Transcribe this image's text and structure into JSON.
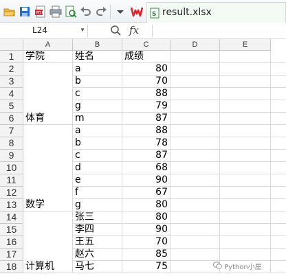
{
  "window": {
    "tab_title": "result.xlsx"
  },
  "toolbar": {
    "icons": [
      "open-folder-icon",
      "save-icon",
      "export-pdf-icon",
      "print-icon",
      "print-preview-icon",
      "undo-icon",
      "redo-icon",
      "more-chevron-icon",
      "wps-logo",
      "spreadsheet-file-icon"
    ]
  },
  "formula_bar": {
    "cell_reference": "L24",
    "fx_label": "fx",
    "formula_value": ""
  },
  "sheet": {
    "columns": [
      "A",
      "B",
      "C",
      "D",
      "E"
    ],
    "row_numbers": [
      "1",
      "2",
      "3",
      "4",
      "5",
      "6",
      "7",
      "8",
      "9",
      "10",
      "11",
      "12",
      "13",
      "14",
      "15",
      "16",
      "17",
      "18"
    ],
    "header_row": {
      "a": "学院",
      "b": "姓名",
      "c": "成绩"
    },
    "rows": [
      {
        "b": "a",
        "c": "80"
      },
      {
        "b": "b",
        "c": "70"
      },
      {
        "b": "c",
        "c": "88"
      },
      {
        "b": "g",
        "c": "79"
      },
      {
        "b": "m",
        "c": "87"
      },
      {
        "b": "a",
        "c": "88"
      },
      {
        "b": "b",
        "c": "78"
      },
      {
        "b": "c",
        "c": "87"
      },
      {
        "b": "d",
        "c": "68"
      },
      {
        "b": "e",
        "c": "90"
      },
      {
        "b": "f",
        "c": "67"
      },
      {
        "b": "g",
        "c": "80"
      },
      {
        "b": "张三",
        "c": "80"
      },
      {
        "b": "李四",
        "c": "90"
      },
      {
        "b": "王五",
        "c": "70"
      },
      {
        "b": "赵六",
        "c": "85"
      },
      {
        "b": "马七",
        "c": "75"
      }
    ],
    "merged_a": [
      {
        "label": "体育"
      },
      {
        "label": "数学"
      },
      {
        "label": "计算机"
      }
    ]
  },
  "watermark": {
    "text": "Python小屋"
  },
  "colors": {
    "accent_red": "#d9262b",
    "tab_green": "#2e8b3e",
    "save_blue": "#2a6bc4"
  }
}
